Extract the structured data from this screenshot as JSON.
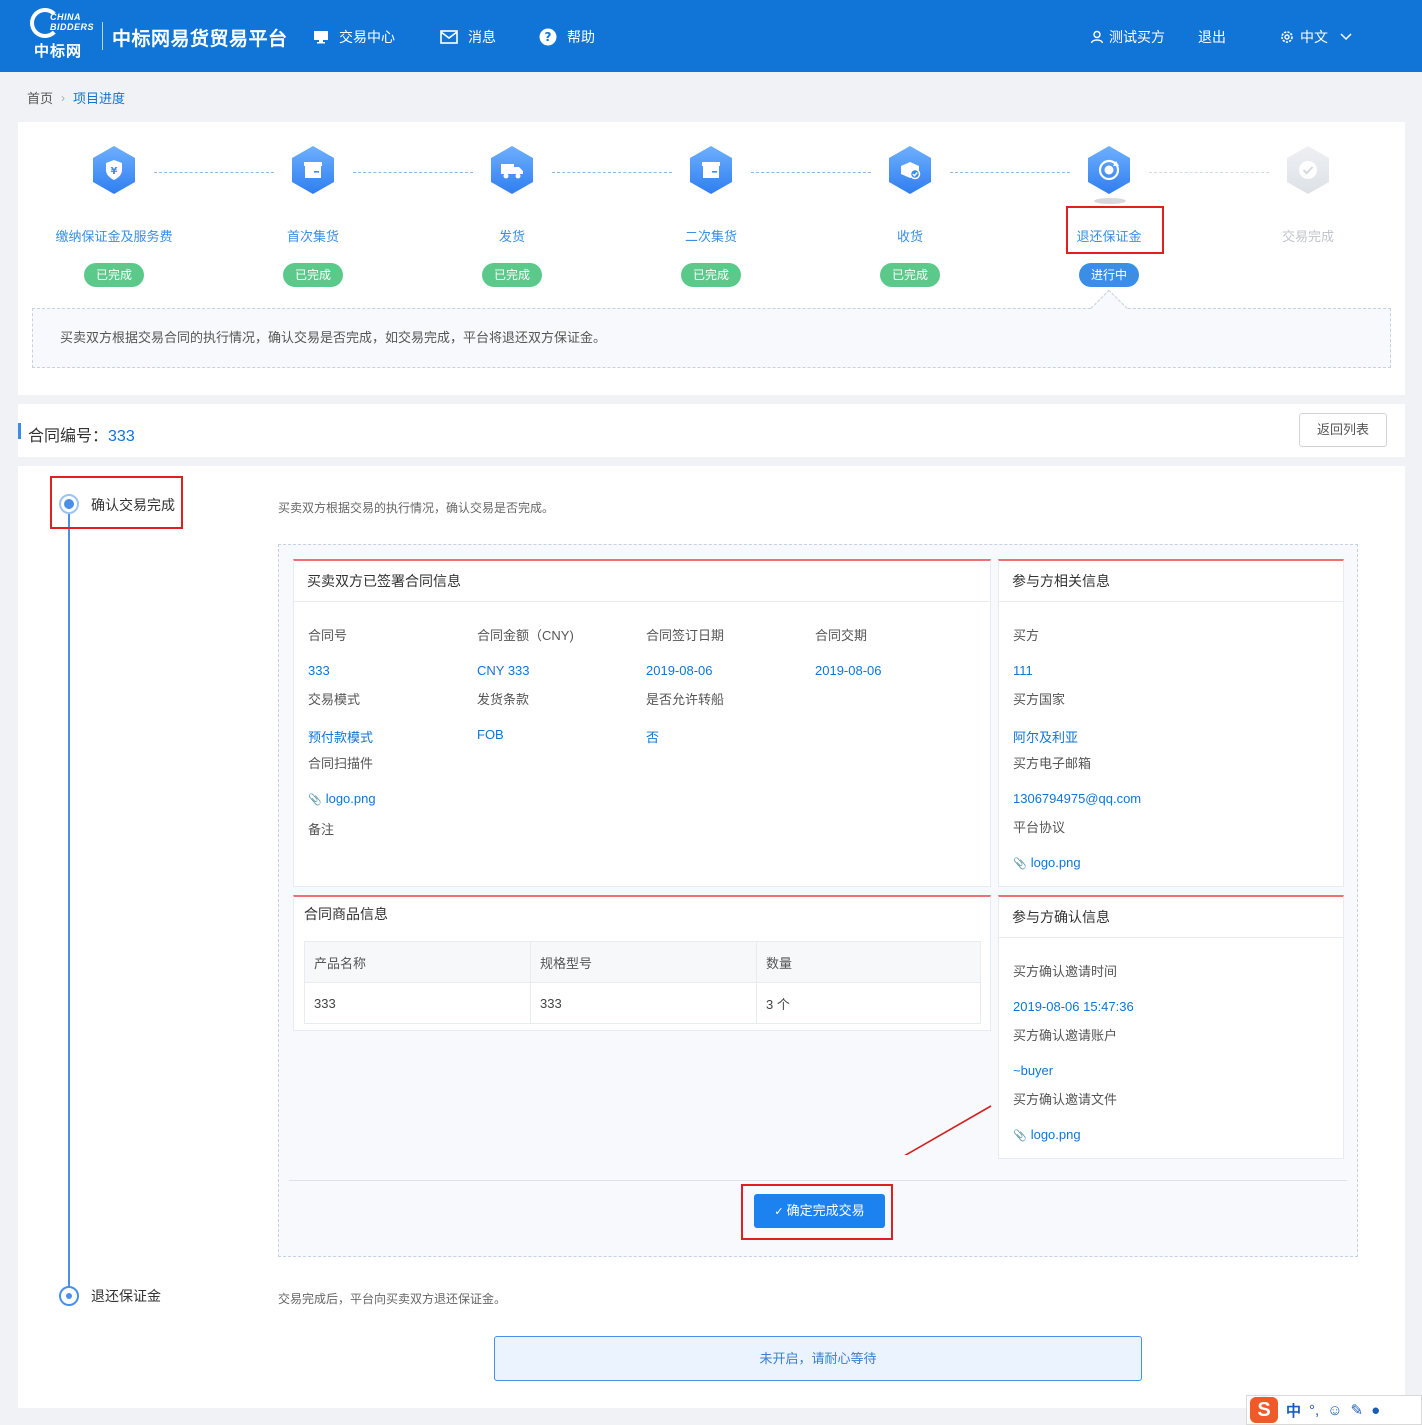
{
  "header": {
    "logo_en": "CHINA BIDDERS",
    "logo_cn": "中标网",
    "brand": "中标网易货贸易平台",
    "nav": [
      {
        "label": "交易中心",
        "icon": "monitor-icon"
      },
      {
        "label": "消息",
        "icon": "mail-icon"
      },
      {
        "label": "帮助",
        "icon": "help-icon"
      }
    ],
    "user": "测试买方",
    "logout": "退出",
    "language": "中文"
  },
  "breadcrumb": {
    "home": "首页",
    "current": "项目进度"
  },
  "steps": [
    {
      "label": "缴纳保证金及服务费",
      "status": "已完成",
      "icon": "shield-yen-icon"
    },
    {
      "label": "首次集货",
      "status": "已完成",
      "icon": "box-icon"
    },
    {
      "label": "发货",
      "status": "已完成",
      "icon": "truck-icon"
    },
    {
      "label": "二次集货",
      "status": "已完成",
      "icon": "box-icon"
    },
    {
      "label": "收货",
      "status": "已完成",
      "icon": "package-check-icon"
    },
    {
      "label": "退还保证金",
      "status": "进行中",
      "icon": "refund-icon"
    },
    {
      "label": "交易完成",
      "status": "",
      "icon": "check-circle-icon"
    }
  ],
  "step_description": "买卖双方根据交易合同的执行情况，确认交易是否完成，如交易完成，平台将退还双方保证金。",
  "contract": {
    "label": "合同编号：",
    "number": "333",
    "back_button": "返回列表"
  },
  "timeline": {
    "stage1": {
      "label": "确认交易完成",
      "desc": "买卖双方根据交易的执行情况，确认交易是否完成。"
    },
    "stage2": {
      "label": "退还保证金",
      "desc": "交易完成后，平台向买卖双方退还保证金。"
    }
  },
  "contract_info": {
    "title": "买卖双方已签署合同信息",
    "contract_no_label": "合同号",
    "contract_no": "333",
    "amount_label": "合同金额（CNY)",
    "amount": "CNY 333",
    "sign_date_label": "合同签订日期",
    "sign_date": "2019-08-06",
    "delivery_label": "合同交期",
    "delivery": "2019-08-06",
    "mode_label": "交易模式",
    "mode": "预付款模式",
    "terms_label": "发货条款",
    "terms": "FOB",
    "transship_label": "是否允许转船",
    "transship": "否",
    "scan_label": "合同扫描件",
    "scan_file": "logo.png",
    "remark_label": "备注"
  },
  "party_info": {
    "title": "参与方相关信息",
    "buyer_label": "买方",
    "buyer": "111",
    "country_label": "买方国家",
    "country": "阿尔及利亚",
    "email_label": "买方电子邮箱",
    "email": "1306794975@qq.com",
    "agreement_label": "平台协议",
    "agreement_file": "logo.png"
  },
  "goods": {
    "title": "合同商品信息",
    "columns": [
      "产品名称",
      "规格型号",
      "数量"
    ],
    "rows": [
      [
        "333",
        "333",
        "3 个"
      ]
    ]
  },
  "confirm_info": {
    "title": "参与方确认信息",
    "time_label": "买方确认邀请时间",
    "time": "2019-08-06 15:47:36",
    "account_label": "买方确认邀请账户",
    "account": "~buyer",
    "file_label": "买方确认邀请文件",
    "file": "logo.png"
  },
  "confirm_button": "确定完成交易",
  "wait_message": "未开启，请耐心等待",
  "ime": {
    "lang": "中",
    "punct": "°,"
  },
  "colors": {
    "primary": "#1075d6",
    "done": "#5ac98a",
    "highlight": "#e02020"
  }
}
